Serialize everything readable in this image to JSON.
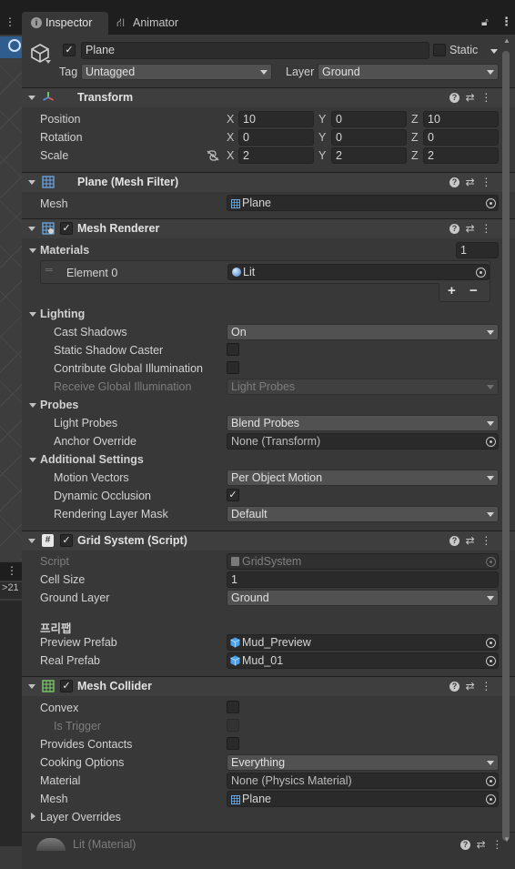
{
  "tabs": {
    "inspector_label": "Inspector",
    "animator_label": "Animator"
  },
  "scene_strip": {
    "count_label": "21"
  },
  "gameobject": {
    "name": "Plane",
    "active": true,
    "static_label": "Static",
    "tag_label": "Tag",
    "tag_value": "Untagged",
    "layer_label": "Layer",
    "layer_value": "Ground"
  },
  "transform": {
    "title": "Transform",
    "position_label": "Position",
    "rotation_label": "Rotation",
    "scale_label": "Scale",
    "axis_x": "X",
    "axis_y": "Y",
    "axis_z": "Z",
    "position": [
      "10",
      "0",
      "10"
    ],
    "rotation": [
      "0",
      "0",
      "0"
    ],
    "scale": [
      "2",
      "2",
      "2"
    ]
  },
  "mesh_filter": {
    "title": "Plane (Mesh Filter)",
    "mesh_label": "Mesh",
    "mesh_value": "Plane"
  },
  "mesh_renderer": {
    "title": "Mesh Renderer",
    "enabled": true,
    "materials_label": "Materials",
    "materials_count": "1",
    "element0_label": "Element 0",
    "element0_value": "Lit",
    "add_label": "+",
    "remove_label": "−",
    "lighting_label": "Lighting",
    "cast_shadows_label": "Cast Shadows",
    "cast_shadows_value": "On",
    "static_shadow_caster_label": "Static Shadow Caster",
    "contribute_gi_label": "Contribute Global Illumination",
    "receive_gi_label": "Receive Global Illumination",
    "receive_gi_value": "Light Probes",
    "probes_label": "Probes",
    "light_probes_label": "Light Probes",
    "light_probes_value": "Blend Probes",
    "anchor_override_label": "Anchor Override",
    "anchor_override_value": "None (Transform)",
    "additional_label": "Additional Settings",
    "motion_vectors_label": "Motion Vectors",
    "motion_vectors_value": "Per Object Motion",
    "dynamic_occlusion_label": "Dynamic Occlusion",
    "rendering_layer_mask_label": "Rendering Layer Mask",
    "rendering_layer_mask_value": "Default"
  },
  "grid_system": {
    "title": "Grid System (Script)",
    "enabled": true,
    "script_label": "Script",
    "script_value": "GridSystem",
    "cell_size_label": "Cell Size",
    "cell_size_value": "1",
    "ground_layer_label": "Ground Layer",
    "ground_layer_value": "Ground",
    "prefab_section": "프리팹",
    "preview_prefab_label": "Preview Prefab",
    "preview_prefab_value": "Mud_Preview",
    "real_prefab_label": "Real Prefab",
    "real_prefab_value": "Mud_01"
  },
  "mesh_collider": {
    "title": "Mesh Collider",
    "enabled": true,
    "convex_label": "Convex",
    "is_trigger_label": "Is Trigger",
    "provides_contacts_label": "Provides Contacts",
    "cooking_options_label": "Cooking Options",
    "cooking_options_value": "Everything",
    "material_label": "Material",
    "material_value": "None (Physics Material)",
    "mesh_label": "Mesh",
    "mesh_value": "Plane",
    "layer_overrides_label": "Layer Overrides"
  },
  "material_preview": {
    "title": "Lit (Material)"
  },
  "colors": {
    "panel_bg": "#383838",
    "header_bg": "#3e3e3e",
    "field_bg": "#2a2a2a",
    "dropdown_bg": "#515151",
    "tab_bar_bg": "#1e1e1e"
  }
}
